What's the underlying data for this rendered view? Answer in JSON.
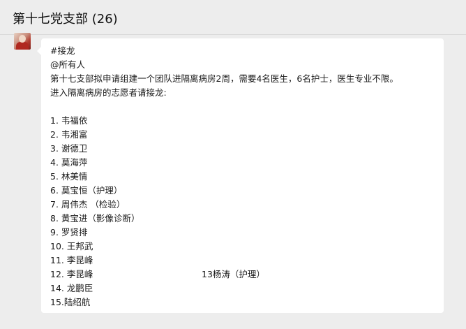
{
  "header": {
    "title": "第十七党支部 (26)"
  },
  "message": {
    "tag": "#接龙",
    "mention": "@所有人",
    "body_line1": "第十七支部拟申请组建一个团队进隔离病房2周，需要4名医生，6名护士，医生专业不限。",
    "body_line2": "进入隔离病房的志愿者请接龙:",
    "list": [
      {
        "text": "1. 韦福依"
      },
      {
        "text": "2. 韦湘富"
      },
      {
        "text": "3. 谢德卫"
      },
      {
        "text": "4. 莫海萍"
      },
      {
        "text": "5. 林美情"
      },
      {
        "text": "6. 莫宝恒（护理）"
      },
      {
        "text": "7. 周伟杰 （检验）"
      },
      {
        "text": "8. 黄宝进（影像诊断）"
      },
      {
        "text": "9. 罗贤排"
      },
      {
        "text": "10. 王邦武"
      },
      {
        "text": "11. 李昆峰"
      },
      {
        "text": "12. 李昆峰",
        "extra": "13杨涛（护理）"
      },
      {
        "text": "14. 龙鹏臣"
      },
      {
        "text": "15.陆绍航"
      }
    ]
  }
}
